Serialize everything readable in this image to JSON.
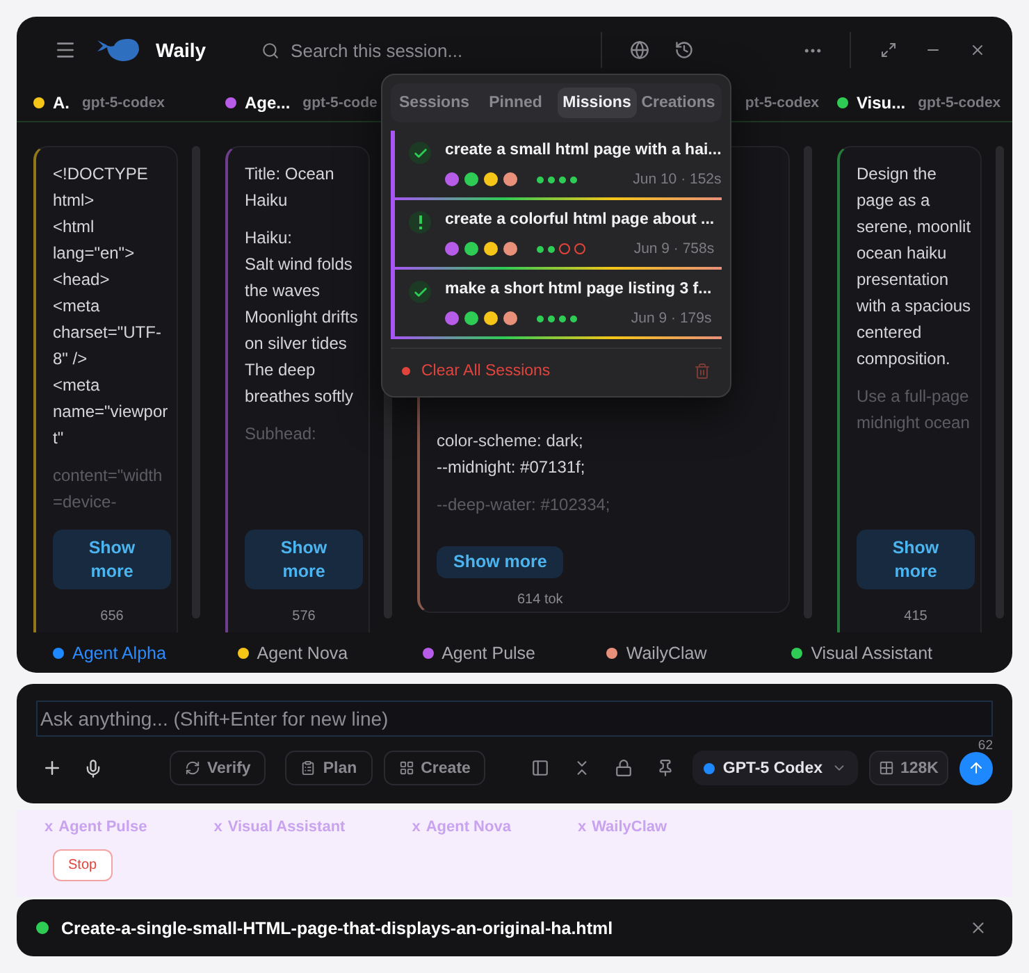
{
  "app": {
    "name": "Waily",
    "search_placeholder": "Search this session..."
  },
  "columns": [
    {
      "name": "A.",
      "color": "#f5c518",
      "model": "gpt-5-codex",
      "kind": "narrow",
      "paragraphs": [
        [
          "<!DOCTYPE html>",
          "<html lang=\"en\">",
          "<head>",
          "<meta charset=\"UTF-8\" />",
          "<meta name=\"viewport\""
        ]
      ],
      "faded_lines": [
        "content=\"width=device-"
      ],
      "show_more": "Show more",
      "count": "656"
    },
    {
      "name": "Age...",
      "color": "#b65ce8",
      "model": "gpt-5-code",
      "kind": "narrow",
      "paragraphs": [
        [
          "Title: Ocean Haiku"
        ],
        [
          "Haiku:",
          "Salt wind folds the waves",
          "Moonlight drifts on silver tides",
          "The deep breathes softly"
        ]
      ],
      "faded_lines": [
        "Subhead:"
      ],
      "show_more": "Show more",
      "count": "576"
    },
    {
      "color": "#e8907a",
      "model": "pt-5-codex",
      "kind": "wide",
      "paragraphs": [
        [
          "color-scheme: dark;",
          "--midnight: #07131f;"
        ]
      ],
      "faded_lines": [
        "--deep-water: #102334;"
      ],
      "show_more": "Show more",
      "count": "614 tok"
    },
    {
      "name": "Visu...",
      "color": "#2ecc55",
      "model": "gpt-5-codex",
      "kind": "narrow",
      "paragraphs": [
        [
          "Design the page as a serene, moonlit ocean haiku presentation with a spacious centered composition."
        ]
      ],
      "faded_lines": [
        "Use a full-page midnight ocean"
      ],
      "show_more": "Show more",
      "count": "415"
    }
  ],
  "legend": [
    {
      "name": "Agent Alpha",
      "color": "#1e88ff",
      "selected": true
    },
    {
      "name": "Agent Nova",
      "color": "#f5c518",
      "selected": false
    },
    {
      "name": "Agent Pulse",
      "color": "#b65ce8",
      "selected": false
    },
    {
      "name": "WailyClaw",
      "color": "#e8907a",
      "selected": false
    },
    {
      "name": "Visual Assistant",
      "color": "#2ecc55",
      "selected": false
    }
  ],
  "popup": {
    "tabs": [
      {
        "label": "Sessions",
        "selected": false
      },
      {
        "label": "Pinned",
        "selected": false
      },
      {
        "label": "Missions",
        "selected": true
      },
      {
        "label": "Creations",
        "selected": false
      }
    ],
    "missions": [
      {
        "warning": false,
        "title": "create a small html page with a hai...",
        "agents": [
          {
            "color": "#b65ce8"
          },
          {
            "color": "#2ecc55"
          },
          {
            "color": "#f5c518"
          },
          {
            "color": "#e8907a"
          }
        ],
        "steps": [
          {
            "failed": false
          },
          {
            "failed": false
          },
          {
            "failed": false
          },
          {
            "failed": false
          }
        ],
        "meta": "Jun 10 · 152s"
      },
      {
        "warning": true,
        "title": "create a colorful html page about ...",
        "agents": [
          {
            "color": "#b65ce8"
          },
          {
            "color": "#2ecc55"
          },
          {
            "color": "#f5c518"
          },
          {
            "color": "#e8907a"
          }
        ],
        "steps": [
          {
            "failed": false
          },
          {
            "failed": false
          },
          {
            "failed": true
          },
          {
            "failed": true
          }
        ],
        "meta": "Jun 9 · 758s"
      },
      {
        "warning": false,
        "title": "make a short html page listing 3 f...",
        "agents": [
          {
            "color": "#b65ce8"
          },
          {
            "color": "#2ecc55"
          },
          {
            "color": "#f5c518"
          },
          {
            "color": "#e8907a"
          }
        ],
        "steps": [
          {
            "failed": false
          },
          {
            "failed": false
          },
          {
            "failed": false
          },
          {
            "failed": false
          }
        ],
        "meta": "Jun 9 · 179s"
      }
    ],
    "clear_label": "Clear All Sessions"
  },
  "composer": {
    "placeholder": "Ask anything... (Shift+Enter for new line)",
    "counter": "62",
    "actions": [
      {
        "kind": "verify",
        "label": "Verify"
      },
      {
        "kind": "plan",
        "label": "Plan"
      },
      {
        "kind": "create",
        "label": "Create"
      }
    ],
    "model": "GPT-5 Codex",
    "context": "128K"
  },
  "activity": {
    "items": [
      {
        "mark": "x",
        "name": "Agent Pulse"
      },
      {
        "mark": "x",
        "name": "Visual Assistant"
      },
      {
        "mark": "x",
        "name": "Agent Nova"
      },
      {
        "mark": "x",
        "name": "WailyClaw"
      }
    ],
    "stop": "Stop"
  },
  "file": {
    "name": "Create-a-single-small-HTML-page-that-displays-an-original-ha.html"
  }
}
